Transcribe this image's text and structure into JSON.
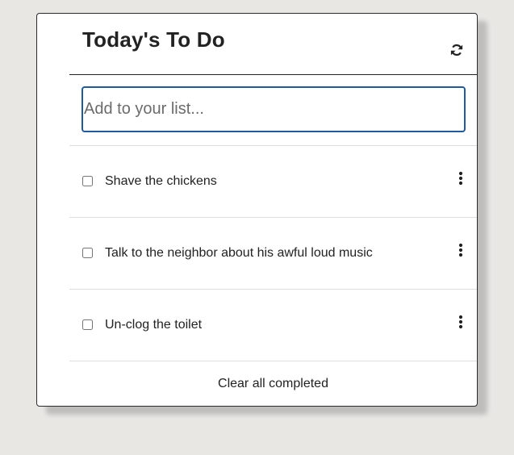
{
  "header": {
    "title": "Today's To Do",
    "refresh_icon": "refresh-icon"
  },
  "add_input": {
    "placeholder": "Add to your list...",
    "value": ""
  },
  "todos": [
    {
      "label": "Shave the chickens",
      "checked": false,
      "menu_icon": "more-vertical-icon"
    },
    {
      "label": "Talk to the neighbor about his awful loud music",
      "checked": false,
      "menu_icon": "more-vertical-icon"
    },
    {
      "label": "Un-clog the toilet",
      "checked": false,
      "menu_icon": "more-vertical-icon"
    }
  ],
  "footer": {
    "clear_label": "Clear all completed"
  },
  "colors": {
    "page_background": "#e8e7e4",
    "card_background": "#ffffff",
    "input_focus_border": "#1f5a9e",
    "text": "#222222"
  }
}
